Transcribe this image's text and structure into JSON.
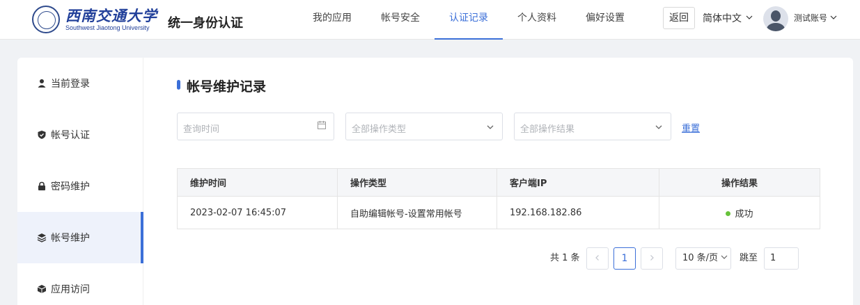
{
  "header": {
    "logo_cn": "西南交通大学",
    "logo_en": "Southwest Jiaotong University",
    "app_title": "统一身份认证",
    "nav": [
      "我的应用",
      "帐号安全",
      "认证记录",
      "个人资料",
      "偏好设置"
    ],
    "active_nav": "认证记录",
    "back_label": "返回",
    "language": "简体中文",
    "user_name": "测试账号"
  },
  "sidebar": {
    "items": [
      {
        "label": "当前登录",
        "icon": "user-icon"
      },
      {
        "label": "帐号认证",
        "icon": "shield-icon"
      },
      {
        "label": "密码维护",
        "icon": "lock-icon"
      },
      {
        "label": "帐号维护",
        "icon": "layers-icon"
      },
      {
        "label": "应用访问",
        "icon": "cube-icon"
      }
    ],
    "active": "帐号维护"
  },
  "main": {
    "title": "帐号维护记录",
    "filters": {
      "time_placeholder": "查询时间",
      "type_placeholder": "全部操作类型",
      "result_placeholder": "全部操作结果",
      "reset_label": "重置"
    },
    "table": {
      "columns": [
        "维护时间",
        "操作类型",
        "客户端IP",
        "操作结果"
      ],
      "rows": [
        {
          "time": "2023-02-07 16:45:07",
          "type": "自助编辑帐号-设置常用帐号",
          "ip": "192.168.182.86",
          "result": "成功"
        }
      ]
    },
    "pagination": {
      "total": "共 1 条",
      "current_page": "1",
      "page_size": "10 条/页",
      "jump_label": "跳至",
      "jump_value": "1"
    }
  },
  "colors": {
    "accent": "#3b6fd8",
    "success": "#67c23a"
  }
}
